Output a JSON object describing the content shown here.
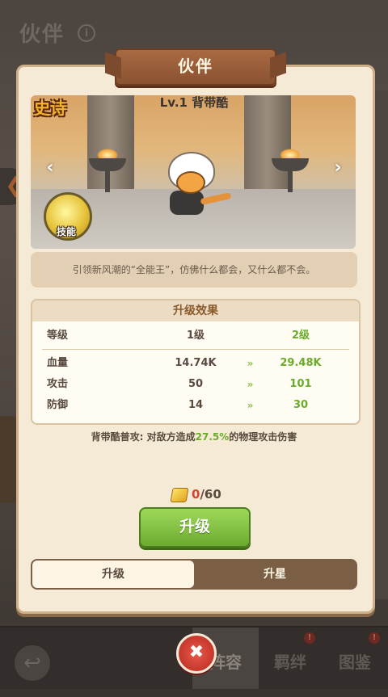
{
  "background": {
    "title": "伙伴",
    "info_glyph": "i",
    "left_arrow_glyph": "❮"
  },
  "panel": {
    "title": "伙伴",
    "rarity": "史诗",
    "hero_name": "Lv.1 背带酷",
    "skill_label": "技能",
    "prev_glyph": "‹",
    "next_glyph": "›",
    "description": "引领新风潮的“全能王”，仿佛什么都会，又什么都不会。"
  },
  "effects": {
    "title": "升级效果",
    "header": {
      "label": "等级",
      "current": "1级",
      "next": "2级"
    },
    "arrow_glyph": "»",
    "rows": [
      {
        "label": "血量",
        "current": "14.74K",
        "next": "29.48K"
      },
      {
        "label": "攻击",
        "current": "50",
        "next": "101"
      },
      {
        "label": "防御",
        "current": "14",
        "next": "30"
      }
    ]
  },
  "attack": {
    "prefix": "背带酷普攻: 对敌方造成",
    "value": "27.5%",
    "suffix": "的物理攻击伤害"
  },
  "cost": {
    "have": "0",
    "sep_need": "/60"
  },
  "upgrade_button": "升级",
  "tabs": {
    "upgrade": "升级",
    "star": "升星"
  },
  "close_glyph": "✖",
  "nav": {
    "back_glyph": "↩",
    "tabs": [
      {
        "label": "阵容"
      },
      {
        "label": "羁绊",
        "badge": "!"
      },
      {
        "label": "图鉴",
        "badge": "!"
      }
    ]
  },
  "colors": {
    "accent_green": "#6bab2a",
    "rarity_gold": "#f7b32b",
    "cost_red": "#d2452e",
    "close_red": "#d2392c"
  }
}
